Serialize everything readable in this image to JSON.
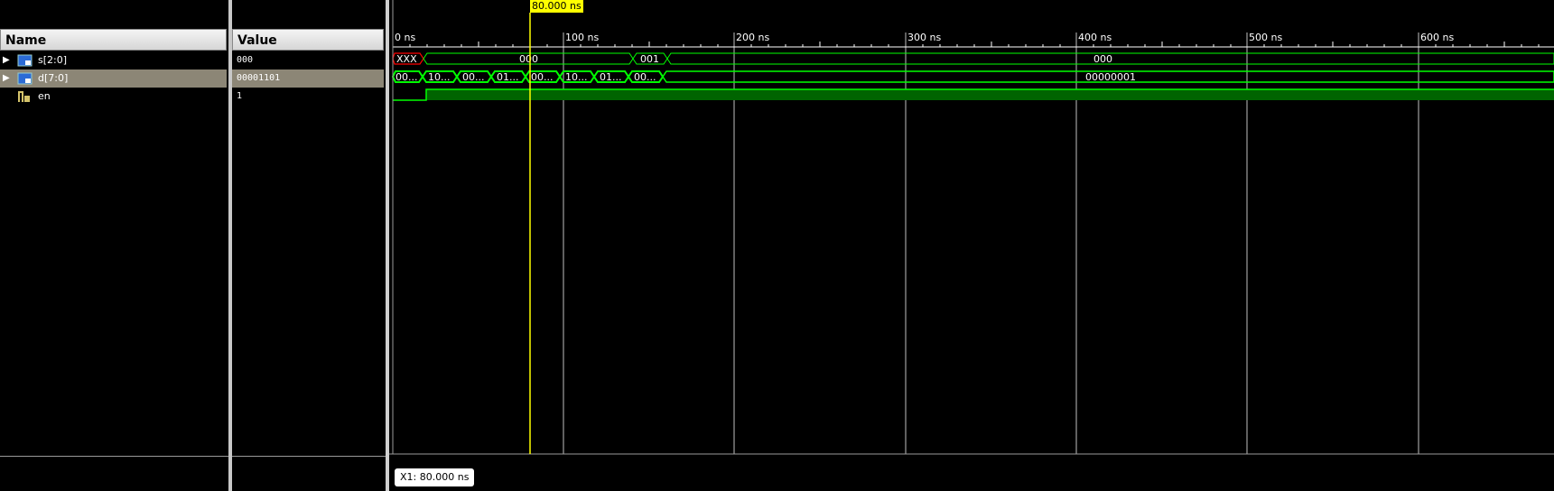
{
  "name_column": {
    "header": "Name"
  },
  "value_column": {
    "header": "Value"
  },
  "signals": [
    {
      "name": "s[2:0]",
      "value": "000",
      "expandable": true,
      "icon": "bus-icon"
    },
    {
      "name": "d[7:0]",
      "value": "00001101",
      "expandable": true,
      "icon": "bus-icon",
      "selected": true
    },
    {
      "name": "en",
      "value": "1",
      "expandable": false,
      "icon": "logic-signal-icon"
    }
  ],
  "timeline": {
    "ticks": [
      "0 ns",
      "100 ns",
      "200 ns",
      "300 ns",
      "400 ns",
      "500 ns",
      "600 ns"
    ],
    "cursor_label": "80.000 ns",
    "x1_label": "X1: 80.000 ns"
  },
  "waveforms": {
    "s": [
      {
        "label": "XXX",
        "state": "unknown"
      },
      {
        "label": "000",
        "state": "valid"
      },
      {
        "label": "001",
        "state": "valid"
      },
      {
        "label": "000",
        "state": "valid"
      }
    ],
    "d": [
      {
        "label": "00..."
      },
      {
        "label": "10..."
      },
      {
        "label": "00..."
      },
      {
        "label": "01..."
      },
      {
        "label": "00..."
      },
      {
        "label": "10..."
      },
      {
        "label": "01..."
      },
      {
        "label": "00..."
      },
      {
        "label": "00000001"
      }
    ]
  },
  "colors": {
    "wave_green": "#00ff00",
    "unknown_red": "#ff0000",
    "cursor_yellow": "#ffff00",
    "selection": "#8c8676"
  }
}
